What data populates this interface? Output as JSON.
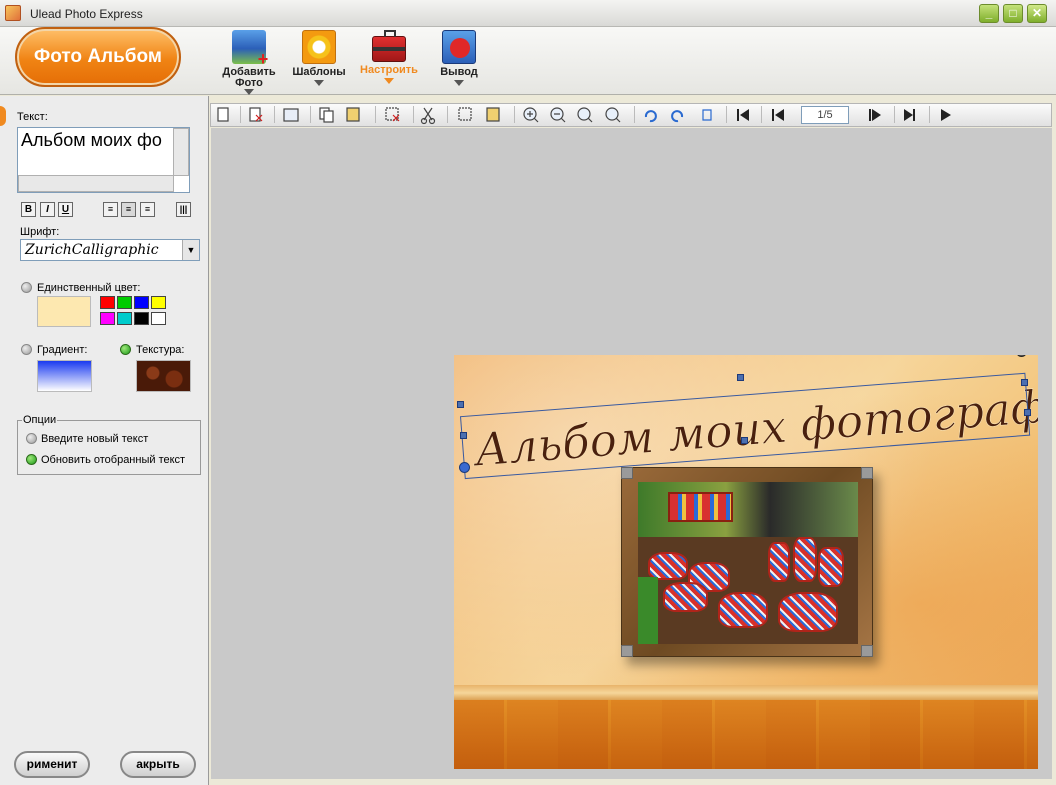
{
  "window": {
    "title": "Ulead Photo Express",
    "controls": [
      "_",
      "□",
      "✕"
    ]
  },
  "header": {
    "album_button": "Фото Альбом",
    "tools": [
      {
        "label": "Добавить Фото",
        "icon": "add-photo-icon"
      },
      {
        "label": "Шаблоны",
        "icon": "templates-icon"
      },
      {
        "label": "Настроить",
        "icon": "toolbox-icon",
        "active": true,
        "color": "#f08a20"
      },
      {
        "label": "Вывод",
        "icon": "output-gift-icon"
      }
    ]
  },
  "left_panel": {
    "text_label": "Текст:",
    "text_value": "Альбом моих фо",
    "format_buttons": [
      "B",
      "I",
      "U"
    ],
    "font_label": "Шрифт:",
    "font_value": "ZurichCalligraphic",
    "single_color_label": "Единственный цвет:",
    "single_color_selected": "#fde8b0",
    "palette": [
      "#ff0000",
      "#00cc00",
      "#0000ff",
      "#ffff00",
      "#ff00ff",
      "#00cccc",
      "#000000",
      "#ffffff"
    ],
    "gradient_label": "Градиент:",
    "texture_label": "Текстура:",
    "options_legend": "Опции",
    "option_new_text": "Введите новый текст",
    "option_update_text": "Обновить отобранный текст",
    "apply_button": "рименит",
    "close_button": "акрыть"
  },
  "toolbar": {
    "page_indicator": "1/5"
  },
  "album_page": {
    "title_text": "Альбом моих фотографий"
  }
}
